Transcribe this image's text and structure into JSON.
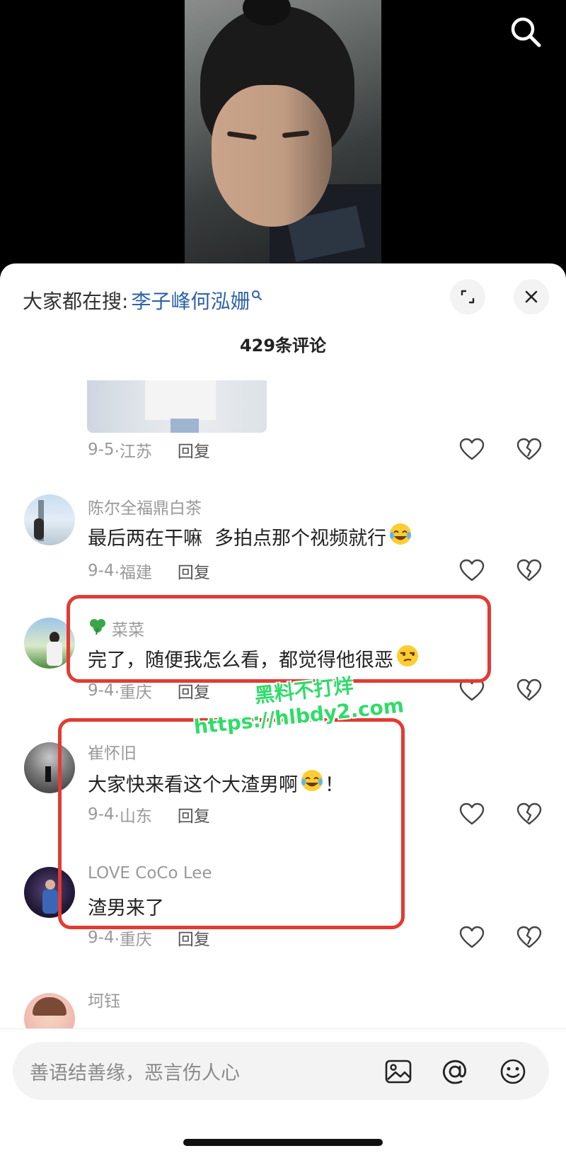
{
  "header": {
    "search_prefix": "大家都在搜:",
    "search_query": "李子峰何泓姗"
  },
  "comment_count": "429条评论",
  "comments": [
    {
      "date": "9-5",
      "location": "·江苏",
      "reply": "回复"
    },
    {
      "username": "陈尔全福鼎白茶",
      "text": "最后两在干嘛  多拍点那个视频就行",
      "emoji": "rolling-on-floor-laughing",
      "date": "9-4",
      "location": "·福建",
      "reply": "回复"
    },
    {
      "username": "菜菜",
      "text": "完了，随便我怎么看，都觉得他很恶",
      "emoji": "unamused-face",
      "date": "9-4",
      "location": "·重庆",
      "reply": "回复"
    },
    {
      "username": "崔怀旧",
      "text": "大家快来看这个大渣男啊",
      "text_suffix": "！",
      "emoji": "rolling-on-floor-laughing",
      "date": "9-4",
      "location": "·山东",
      "reply": "回复"
    },
    {
      "username": "LOVE CoCo Lee",
      "text": "渣男来了",
      "date": "9-4",
      "location": "·重庆",
      "reply": "回复"
    },
    {
      "username": "坷钰"
    }
  ],
  "watermark": {
    "line1": "黑料不打烊",
    "line2": "https://hlbdy2.com"
  },
  "input": {
    "placeholder": "善语结善缘，恶言伤人心"
  },
  "colors": {
    "link": "#2f62a8",
    "annotation_red": "#e23b33",
    "watermark_green": "#2fdc6a"
  }
}
